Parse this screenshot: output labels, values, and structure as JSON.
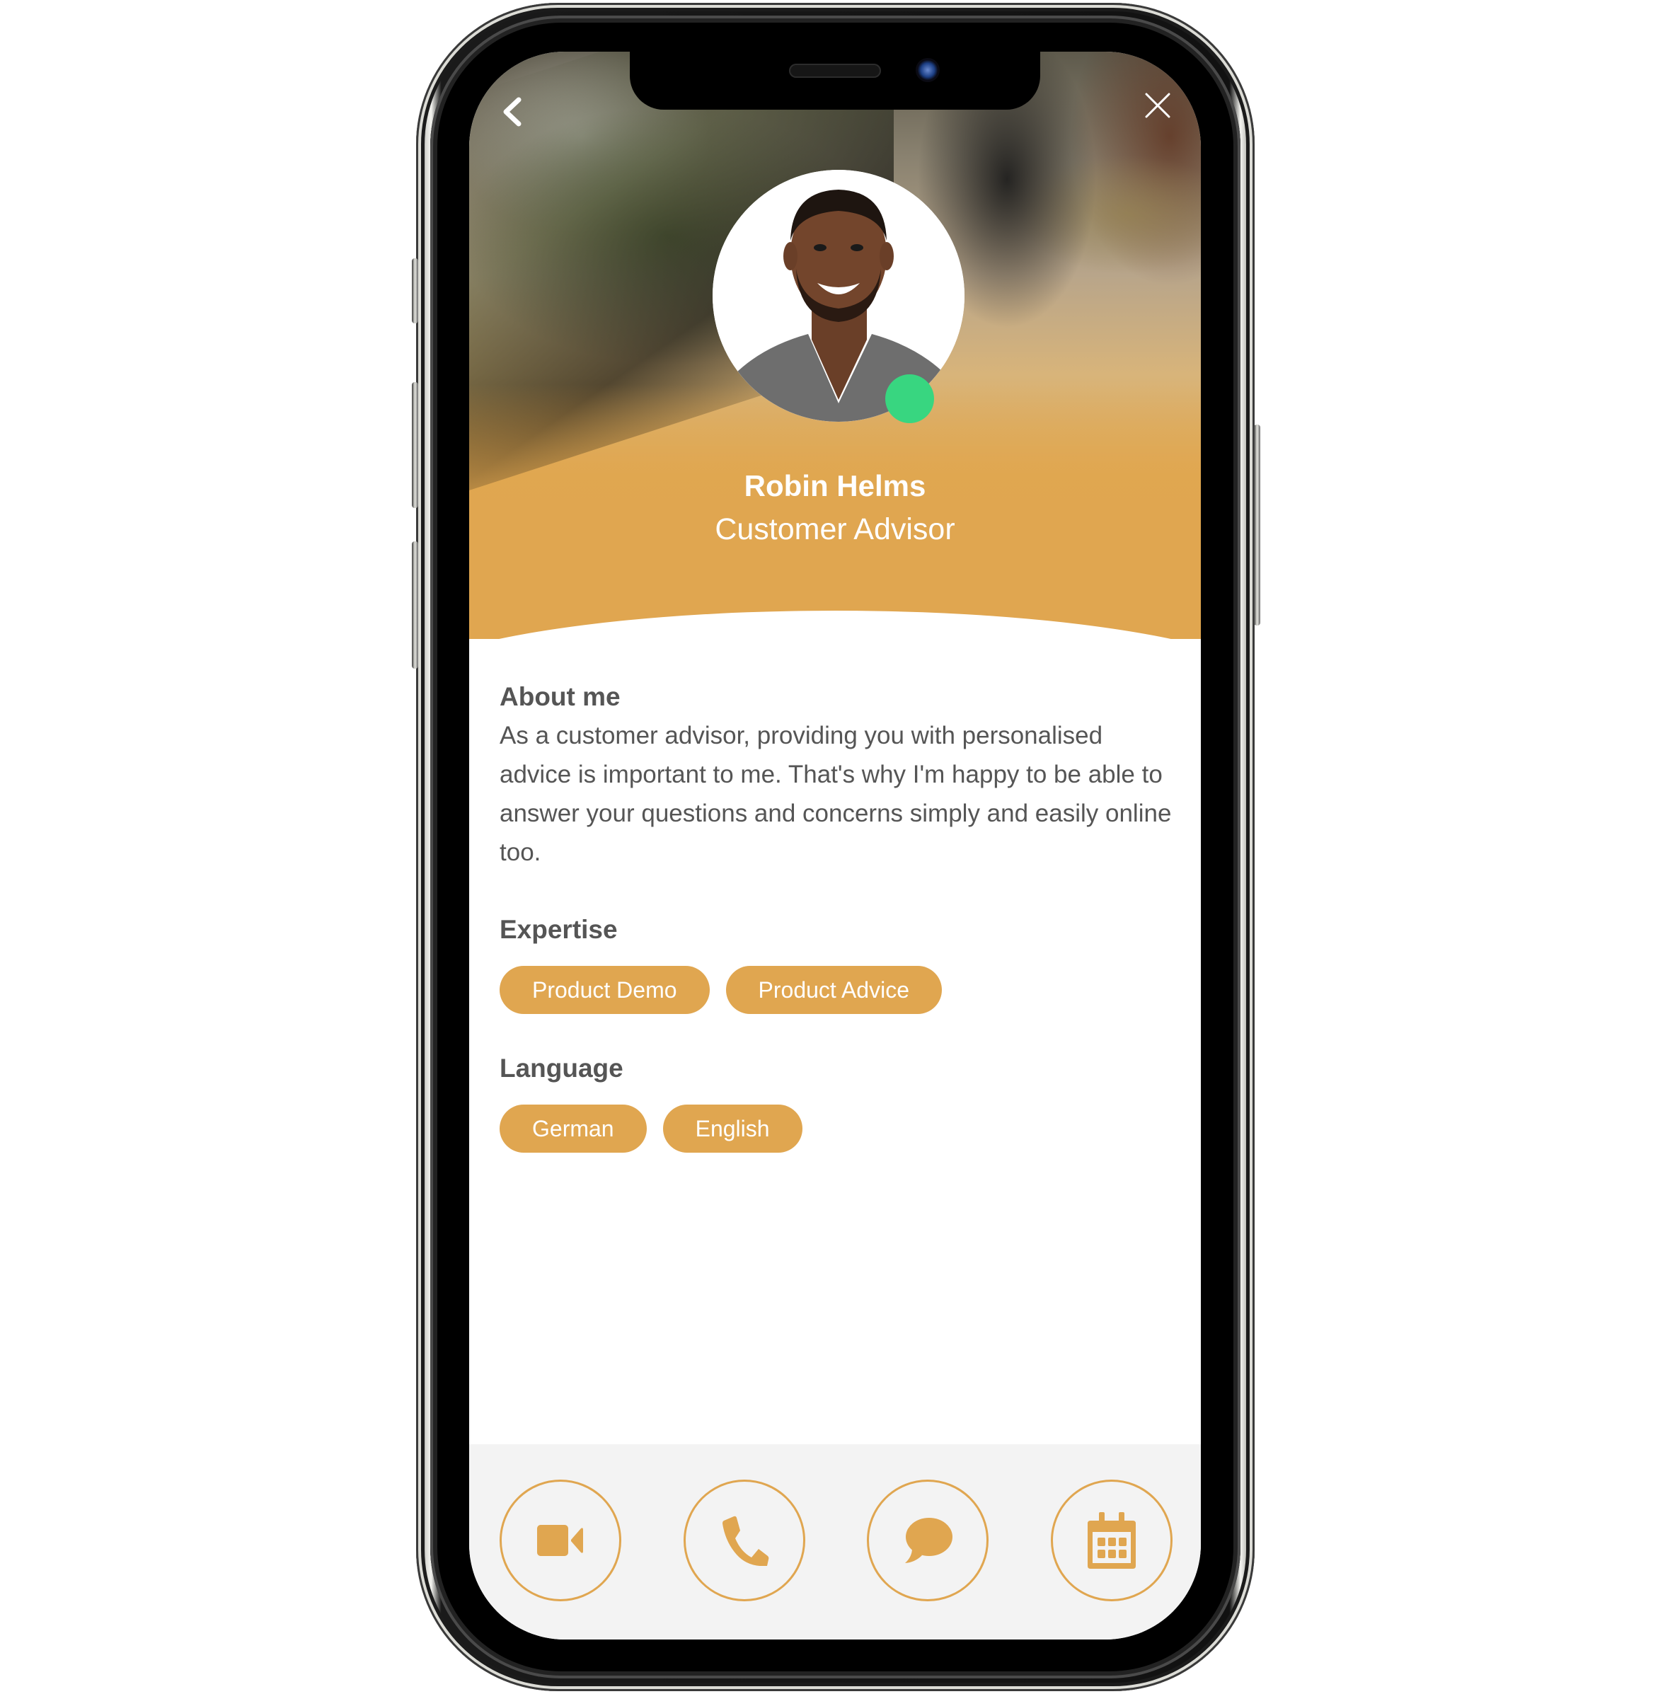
{
  "nav": {
    "back_icon": "chevron-left-icon",
    "close_icon": "close-icon"
  },
  "profile": {
    "name": "Robin Helms",
    "role": "Customer Advisor",
    "status": "online",
    "status_color": "#38d680",
    "accent_color": "#e0a650"
  },
  "about": {
    "title": "About me",
    "text": "As a customer advisor, providing you with personalised advice is important to me. That's why I'm happy to be able to answer your questions and concerns simply and easily online too."
  },
  "expertise": {
    "title": "Expertise",
    "items": [
      {
        "label": "Product Demo"
      },
      {
        "label": "Product Advice"
      }
    ]
  },
  "language": {
    "title": "Language",
    "items": [
      {
        "label": "German"
      },
      {
        "label": "English"
      }
    ]
  },
  "actions": [
    {
      "name": "video-call",
      "icon": "video-camera-icon"
    },
    {
      "name": "phone-call",
      "icon": "phone-icon"
    },
    {
      "name": "chat",
      "icon": "chat-bubble-icon"
    },
    {
      "name": "schedule",
      "icon": "calendar-icon"
    }
  ]
}
